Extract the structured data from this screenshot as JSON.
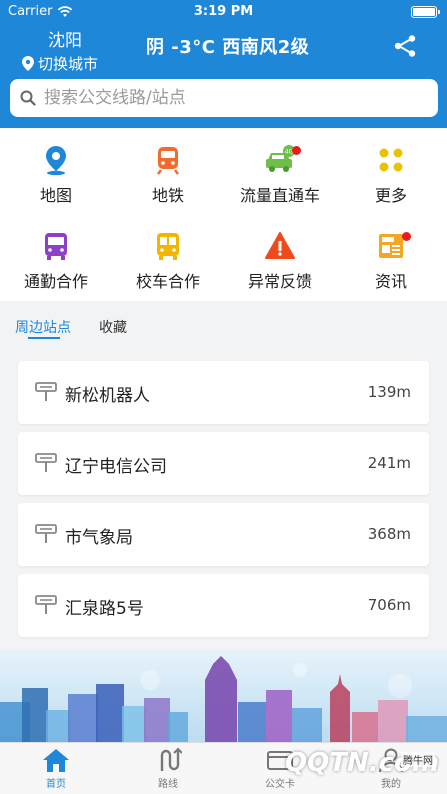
{
  "status_bar": {
    "carrier": "Carrier",
    "time": "3:19 PM"
  },
  "header": {
    "city": "沈阳",
    "switch_city": "切换城市",
    "weather": "阴 -3°C 西南风2级"
  },
  "search": {
    "placeholder": "搜索公交线路/站点"
  },
  "menu": [
    {
      "label": "地图",
      "icon": "map-pin-icon"
    },
    {
      "label": "地铁",
      "icon": "subway-icon"
    },
    {
      "label": "流量直通车",
      "icon": "4g-car-icon",
      "badge": true
    },
    {
      "label": "更多",
      "icon": "more-dots-icon"
    },
    {
      "label": "通勤合作",
      "icon": "commute-bus-icon"
    },
    {
      "label": "校车合作",
      "icon": "school-bus-icon"
    },
    {
      "label": "异常反馈",
      "icon": "warning-icon"
    },
    {
      "label": "资讯",
      "icon": "news-icon",
      "badge": true
    }
  ],
  "tabs": {
    "nearby": "周边站点",
    "favorites": "收藏",
    "active": "nearby"
  },
  "stations": [
    {
      "name": "新松机器人",
      "distance": "139m"
    },
    {
      "name": "辽宁电信公司",
      "distance": "241m"
    },
    {
      "name": "市气象局",
      "distance": "368m"
    },
    {
      "name": "汇泉路5号",
      "distance": "706m"
    }
  ],
  "tabbar": [
    {
      "label": "首页",
      "icon": "home-icon",
      "active": true
    },
    {
      "label": "路线",
      "icon": "route-icon"
    },
    {
      "label": "公交卡",
      "icon": "bus-card-icon"
    },
    {
      "label": "我的",
      "icon": "profile-icon"
    }
  ],
  "watermark": {
    "brand": "QQTN.com",
    "site": "腾牛网"
  },
  "colors": {
    "primary": "#1e87d8",
    "badge": "#e81c1c"
  }
}
